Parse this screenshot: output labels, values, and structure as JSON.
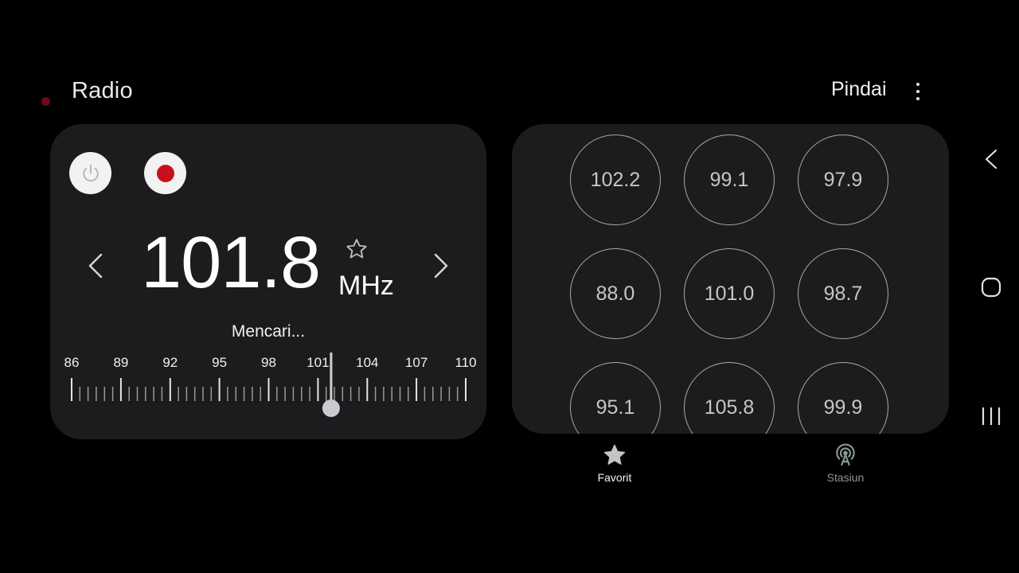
{
  "header": {
    "title": "Radio",
    "scan_label": "Pindai"
  },
  "tuner": {
    "frequency": "101.8",
    "unit": "MHz",
    "status": "Mencari...",
    "dial": {
      "min": 86,
      "max": 110,
      "labels": [
        "86",
        "89",
        "92",
        "95",
        "98",
        "101",
        "104",
        "107",
        "110"
      ],
      "current": 101.8
    }
  },
  "presets": [
    "102.2",
    "99.1",
    "97.9",
    "88.0",
    "101.0",
    "98.7",
    "95.1",
    "105.8",
    "99.9"
  ],
  "bottom_nav": {
    "favorites_label": "Favorit",
    "stations_label": "Stasiun"
  },
  "colors": {
    "background": "#000000",
    "card": "#1c1c1e",
    "record_red": "#c8101c",
    "inactive_tab": "#8a9a96"
  },
  "icons": {
    "power": "power-icon",
    "record": "record-icon",
    "favorite": "star-outline-icon",
    "favorites_tab": "star-filled-icon",
    "stations_tab": "antenna-icon",
    "more": "more-vertical-icon"
  }
}
